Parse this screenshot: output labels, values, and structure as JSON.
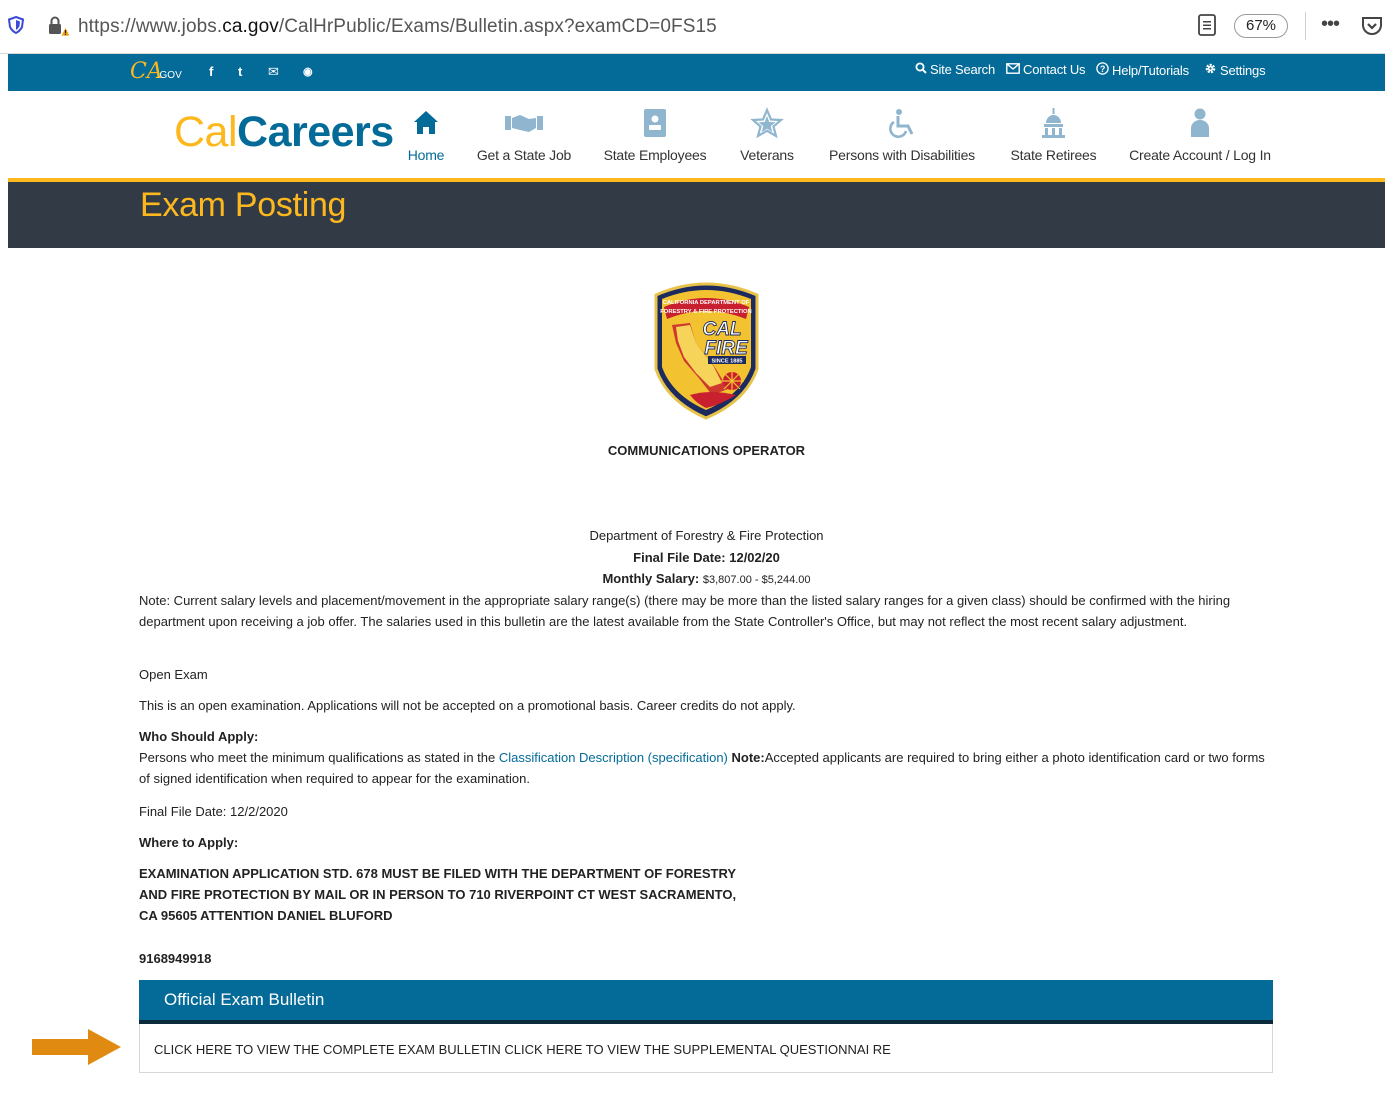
{
  "browser": {
    "url_prefix": "https://www.jobs.",
    "url_host": "ca.gov",
    "url_path": "/CalHrPublic/Exams/Bulletin.aspx?examCD=0FS15",
    "zoom": "67%",
    "icons": [
      "shield-icon",
      "lock-warning-icon",
      "reader-view-icon",
      "more-icon",
      "pocket-icon"
    ]
  },
  "utility_bar": {
    "logo_script": "CA",
    "logo_suffix": ".GOV",
    "social": [
      "f",
      "t",
      "✉",
      "◉"
    ],
    "links": {
      "site_search": "Site Search",
      "contact_us": "Contact Us",
      "help": "Help/Tutorials",
      "settings": "Settings"
    }
  },
  "brand": {
    "part1": "Cal",
    "part2": "Careers"
  },
  "nav": {
    "home": "Home",
    "get_job": "Get a State Job",
    "state_employees": "State Employees",
    "veterans": "Veterans",
    "disabilities": "Persons with Disabilities",
    "retirees": "State Retirees",
    "account": "Create Account / Log In"
  },
  "page": {
    "title": "Exam Posting"
  },
  "seal": {
    "line1": "CALIFORNIA DEPARTMENT OF",
    "line2": "FORESTRY & FIRE PROTECTION",
    "cal": "CAL",
    "fire": "FIRE",
    "since": "SINCE 1885"
  },
  "exam": {
    "title": "COMMUNICATIONS OPERATOR",
    "department": "Department of Forestry & Fire Protection",
    "final_file_date_header": "Final File Date: 12/02/20",
    "salary_label": "Monthly Salary:",
    "salary_value": "$3,807.00 - $5,244.00",
    "salary_note": "Note: Current salary levels and placement/movement in the appropriate salary range(s) (there may be more than the listed salary ranges for a given class) should be confirmed with the hiring department upon receiving a job offer. The salaries used in this bulletin are the latest available from the State Controller's Office, but may not reflect the most recent salary adjustment.",
    "exam_type": "Open Exam",
    "exam_type_desc": "This is an open examination. Applications will not be accepted on a promotional basis. Career credits do not apply.",
    "who_heading": "Who Should Apply:",
    "who_text_1": "Persons who meet the minimum qualifications as stated in the ",
    "who_link": "Classification Description (specification)",
    "who_note_label": " Note:",
    "who_text_2": "Accepted applicants are required to bring either a photo identification card or two forms of signed identification when required to appear for the examination.",
    "final_file_date": "Final File Date: 12/2/2020",
    "where_heading": "Where to Apply:",
    "where_line1": "EXAMINATION APPLICATION STD. 678 MUST BE FILED WITH THE DEPARTMENT OF FORESTRY",
    "where_line2": "AND FIRE PROTECTION BY MAIL OR IN PERSON TO 710 RIVERPOINT CT WEST SACRAMENTO,",
    "where_line3": "CA 95605 ATTENTION DANIEL BLUFORD",
    "phone": "9168949918"
  },
  "bulletin": {
    "title": "Official Exam Bulletin",
    "link1": "CLICK HERE TO VIEW THE COMPLETE EXAM BULLETIN",
    "link2": "CLICK HERE TO VIEW THE SUPPLEMENTAL QUESTIONNAI RE"
  },
  "annotation": {
    "arrow_color": "#e08a12"
  },
  "colors": {
    "primary": "#046b99",
    "accent": "#fdb81e",
    "header_dark": "#323a45"
  }
}
